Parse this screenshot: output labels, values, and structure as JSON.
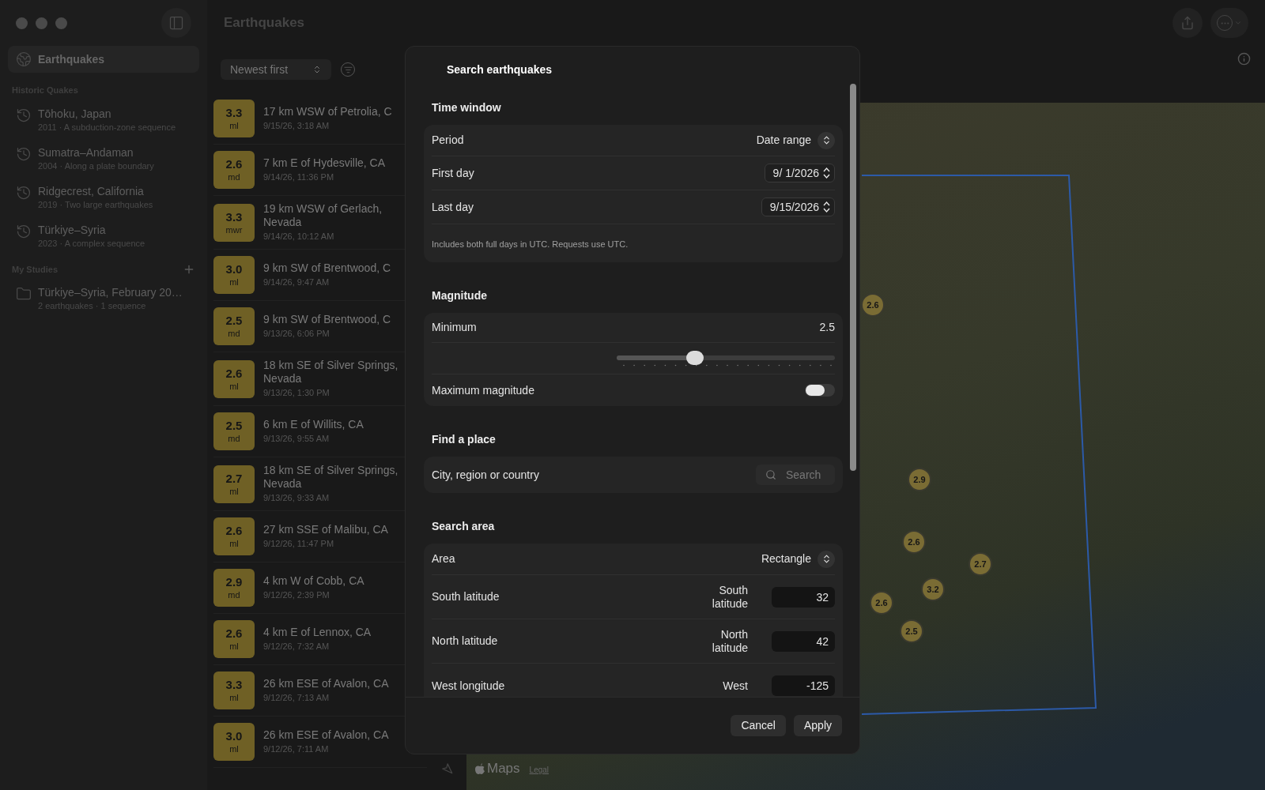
{
  "window": {
    "title": "Earthquakes"
  },
  "sidebar": {
    "items": [
      {
        "label": "Earthquakes",
        "selected": true
      }
    ],
    "sections": [
      {
        "title": "Historic Quakes",
        "addable": false,
        "items": [
          {
            "kind": "history",
            "title": "Tōhoku, Japan",
            "subtitle": "2011 · A subduction-zone sequence"
          },
          {
            "kind": "history",
            "title": "Sumatra–Andaman",
            "subtitle": "2004 · Along a plate boundary"
          },
          {
            "kind": "history",
            "title": "Ridgecrest, California",
            "subtitle": "2019 · Two large earthquakes"
          },
          {
            "kind": "history",
            "title": "Türkiye–Syria",
            "subtitle": "2023 · A complex sequence"
          }
        ]
      },
      {
        "title": "My Studies",
        "addable": true,
        "items": [
          {
            "kind": "folder",
            "title": "Türkiye–Syria, February 20…",
            "subtitle": "2 earthquakes · 1 sequence"
          }
        ]
      }
    ]
  },
  "sort": {
    "value": "Newest first"
  },
  "quakes": [
    {
      "magnitude": "3.3",
      "type": "ml",
      "place": "17 km WSW of Petrolia, C",
      "time": "9/15/26, 3:18 AM"
    },
    {
      "magnitude": "2.6",
      "type": "md",
      "place": "7 km E of Hydesville, CA",
      "time": "9/14/26, 11:36 PM"
    },
    {
      "magnitude": "3.3",
      "type": "mwr",
      "place": "19 km WSW of Gerlach, Nevada",
      "time": "9/14/26, 10:12 AM"
    },
    {
      "magnitude": "3.0",
      "type": "ml",
      "place": "9 km SW of Brentwood, C",
      "time": "9/14/26, 9:47 AM"
    },
    {
      "magnitude": "2.5",
      "type": "md",
      "place": "9 km SW of Brentwood, C",
      "time": "9/13/26, 6:06 PM"
    },
    {
      "magnitude": "2.6",
      "type": "ml",
      "place": "18 km SE of Silver Springs, Nevada",
      "time": "9/13/26, 1:30 PM"
    },
    {
      "magnitude": "2.5",
      "type": "md",
      "place": "6 km E of Willits, CA",
      "time": "9/13/26, 9:55 AM"
    },
    {
      "magnitude": "2.7",
      "type": "ml",
      "place": "18 km SE of Silver Springs, Nevada",
      "time": "9/13/26, 9:33 AM"
    },
    {
      "magnitude": "2.6",
      "type": "ml",
      "place": "27 km SSE of Malibu, CA",
      "time": "9/12/26, 11:47 PM"
    },
    {
      "magnitude": "2.9",
      "type": "md",
      "place": "4 km W of Cobb, CA",
      "time": "9/12/26, 2:39 PM"
    },
    {
      "magnitude": "2.6",
      "type": "ml",
      "place": "4 km E of Lennox, CA",
      "time": "9/12/26, 7:32 AM"
    },
    {
      "magnitude": "3.3",
      "type": "ml",
      "place": "26 km ESE of Avalon, CA",
      "time": "9/12/26, 7:13 AM"
    },
    {
      "magnitude": "3.0",
      "type": "ml",
      "place": "26 km ESE of Avalon, CA",
      "time": "9/12/26, 7:11 AM"
    }
  ],
  "map": {
    "markers": [
      {
        "label": "2.6"
      },
      {
        "label": "2.9"
      },
      {
        "label": "2.6"
      },
      {
        "label": "2.7"
      },
      {
        "label": "3.2"
      },
      {
        "label": "2.6"
      },
      {
        "label": "2.5"
      }
    ],
    "attribution": "Maps",
    "legal": "Legal"
  },
  "dialog": {
    "title": "Search earthquakes",
    "sections": [
      {
        "title": "Time window",
        "rows": [
          {
            "kind": "picker",
            "label": "Period",
            "value": "Date range"
          },
          {
            "kind": "date",
            "label": "First day",
            "value": "9/ 1/2026"
          },
          {
            "kind": "date",
            "label": "Last day",
            "value": "9/15/2026"
          },
          {
            "kind": "note",
            "text": "Includes both full days in UTC. Requests use UTC."
          }
        ]
      },
      {
        "title": "Magnitude",
        "rows": [
          {
            "kind": "value",
            "label": "Minimum",
            "value": "2.5"
          },
          {
            "kind": "slider",
            "level": 0.36
          },
          {
            "kind": "toggle",
            "label": "Maximum magnitude",
            "on": false
          }
        ]
      },
      {
        "title": "Find a place",
        "rows": [
          {
            "kind": "search",
            "label": "City, region or country",
            "placeholder": "Search"
          }
        ]
      },
      {
        "title": "Search area",
        "rows": [
          {
            "kind": "picker",
            "label": "Area",
            "value": "Rectangle"
          },
          {
            "kind": "field",
            "label": "South latitude",
            "field_label": "South latitude",
            "value": "32"
          },
          {
            "kind": "field",
            "label": "North latitude",
            "field_label": "North latitude",
            "value": "42"
          },
          {
            "kind": "field",
            "label": "West longitude",
            "field_label": "West",
            "value": "-125"
          }
        ]
      }
    ],
    "buttons": [
      {
        "label": "Cancel"
      },
      {
        "label": "Apply"
      }
    ]
  }
}
